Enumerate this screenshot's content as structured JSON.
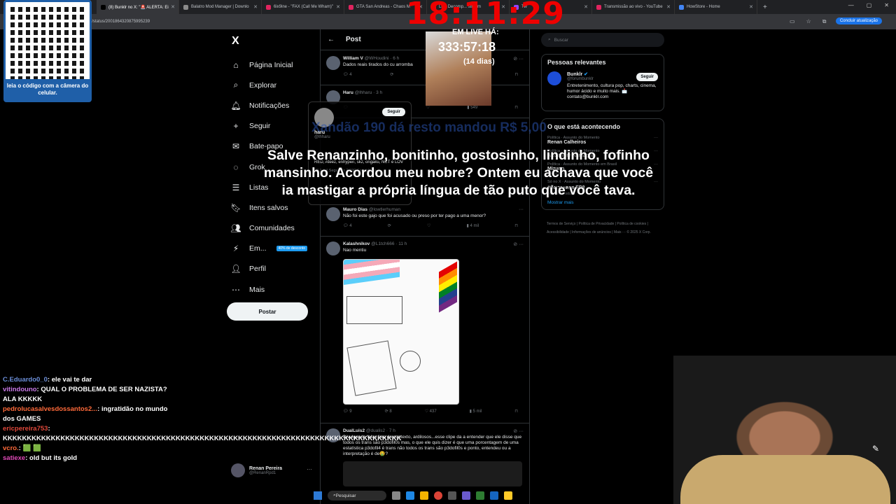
{
  "browser": {
    "tabs": [
      {
        "label": "(8) Bunklr no X: \"🚨 ALERTA: Ei",
        "color": "#000000",
        "active": true
      },
      {
        "label": "Balatro Mod Manager | Downlo",
        "color": "#8a8a8a",
        "active": false
      },
      {
        "label": "6ix9ine - \"FAX (Call Me Wham)\"",
        "color": "#e0245e",
        "active": false
      },
      {
        "label": "GTA San Andreas - Chaos M",
        "color": "#e0245e",
        "active": false
      },
      {
        "label": "Live Decomp... stream",
        "color": "#e0245e",
        "active": false
      },
      {
        "label": "Tw",
        "color": "#9146ff",
        "active": false
      },
      {
        "label": "Transmissão ao vivo - YouTube",
        "color": "#e0245e",
        "active": false
      },
      {
        "label": "HowStore - Home",
        "color": "#4285f4",
        "active": false
      }
    ],
    "new_tab": "+",
    "url": "i/status/2001864320875995239",
    "update_button": "Concluir atualização"
  },
  "nav": {
    "logo": "X",
    "items": [
      {
        "name": "home",
        "icon": "⌂",
        "label": "Página Inicial"
      },
      {
        "name": "explore",
        "icon": "⌕",
        "label": "Explorar"
      },
      {
        "name": "notifications",
        "icon": "🔔︎",
        "label": "Notificações"
      },
      {
        "name": "follow",
        "icon": "+",
        "label": "Seguir"
      },
      {
        "name": "chat",
        "icon": "✉",
        "label": "Bate-papo"
      },
      {
        "name": "grok",
        "icon": "◌",
        "label": "Grok"
      },
      {
        "name": "lists",
        "icon": "☰",
        "label": "Listas"
      },
      {
        "name": "bookmarks",
        "icon": "🔖︎",
        "label": "Itens salvos"
      },
      {
        "name": "communities",
        "icon": "👥︎",
        "label": "Comunidades"
      },
      {
        "name": "premium",
        "icon": "⚡︎",
        "label": "Em..."
      },
      {
        "name": "profile",
        "icon": "👤︎",
        "label": "Perfil"
      },
      {
        "name": "more",
        "icon": "⋯",
        "label": "Mais"
      }
    ],
    "promo": "40% de desconto",
    "post_button": "Postar",
    "user": {
      "name": "Renan Pereira",
      "handle": "@RenanRpd1"
    }
  },
  "timeline": {
    "title": "Post",
    "tweets": [
      {
        "name": "William V",
        "handle": "@WHoudini · 6 h",
        "text": "Dados reais tirados do cu arromba",
        "replies": "4",
        "likes": "",
        "views": ""
      },
      {
        "name": "Haru",
        "handle": "@lhharu · 3 h",
        "text": "",
        "replies": "",
        "likes": "549",
        "views": ""
      },
      {
        "name": "Mauro Dias",
        "handle": "@lowtlerhuman",
        "text": "Não foi este gajo que foi acusado ou preso por ter pago a uma menor?",
        "replies": "4",
        "likes": "",
        "views": "4 mil"
      },
      {
        "name": "Kalashnikov",
        "handle": "@L1tch666 · 11 h",
        "text": "Nao mentiu",
        "replies": "9",
        "retweets": "8",
        "likes": "437",
        "views": "5 mil"
      },
      {
        "name": "DualLuis2",
        "handle": "@dualis2 · 7 h",
        "text": "Divulgando falas fora de contexto, ardilosos...esse clipe da a entender que ele disse que todos os trans são p3dofil0s mas, o que ele quis dizer é que uma porcentagem de uma estatística p3dofil4 é trans não todos os trans são p3dofil0s e ponto, entendeu ou a interpretação é de🤮?"
      }
    ]
  },
  "popcard": {
    "follow": "Seguir",
    "name": "haru",
    "handle": "@lhharu",
    "bio": "RED, Ateez, enhypen, skz, ongaku, NCT e LOV",
    "stats": "32,1 mil Seguindo   2,390 Seguidores"
  },
  "right": {
    "search_placeholder": "Buscar",
    "relevant_title": "Pessoas relevantes",
    "relevant": {
      "name": "Bunklr",
      "handle": "@forumbunklr",
      "bio": "Entretenimento, cultura pop, charts, cinema, humor ácido e muito mais. 📩 contato@bunklr.com",
      "follow": "Seguir"
    },
    "happening_title": "O que está acontecendo",
    "trends": [
      {
        "context": "Política · Assunto do Momento",
        "title": "Renan Calheiros",
        "count": ""
      },
      {
        "context": "Política · Assunto do Momento",
        "title": "Alexandre Ramagem",
        "count": ""
      },
      {
        "context": "Política · Assunto do Momento em Brasil",
        "title": "Mizuno",
        "count": "2.989 posts"
      },
      {
        "context": "Só no X · Assunto do Momento",
        "title": "#สังเวาะคาย EP8",
        "count": "86,8 mil posts"
      }
    ],
    "show_more": "Mostrar mais",
    "footer": "Termos de Serviço | Política de Privacidade | Política de cookies | Acessibilidade | Informações de anúncios | Mais ··· © 2025 X Corp."
  },
  "stream": {
    "qr_caption": "leia o código com a câmera do celular.",
    "clock": "18:11:29",
    "live_label": "EM LIVE HÁ:",
    "live_duration": "333:57:18",
    "live_days": "(14 dias)",
    "ghost_text": "Xandão 190 dá resto mandou R$ 5,00",
    "overlay_message": "Salve Renanzinho, bonitinho, gostosinho, lindinho, fofinho mansinho. Acordou meu nobre? Ontem eu achava que você ia mastigar a própria língua de tão puto que você tava."
  },
  "chat": [
    {
      "user": "C.Eduardo0_0",
      "text": ": ele vai te dar",
      "cls": "u1"
    },
    {
      "user": "vitindouno",
      "text": ": QUAL O PROBLEMA DE SER NAZISTA? ALA KKKKK",
      "cls": "u2"
    },
    {
      "user": "pedrolucasalvesdossantos2...",
      "text": ": ingratidão no mundo dos GAMES",
      "cls": "u3"
    },
    {
      "user": "ericpereira753",
      "text": ": KKKKKKKKKKKKKKKKKKKKKKKKKKKKKKKKKKKKKKKKKKKKKKKKKKKKKKKKKKKKKKKKKKKKKKKKKKKKKKKKKKK",
      "cls": "u4"
    },
    {
      "user": "vcro.",
      "text": ": 🟩 🟩",
      "cls": "u3"
    },
    {
      "user": "satiexe",
      "text": ": old but its gold",
      "cls": "u5"
    }
  ],
  "taskbar": {
    "search": "Pesquisar"
  }
}
